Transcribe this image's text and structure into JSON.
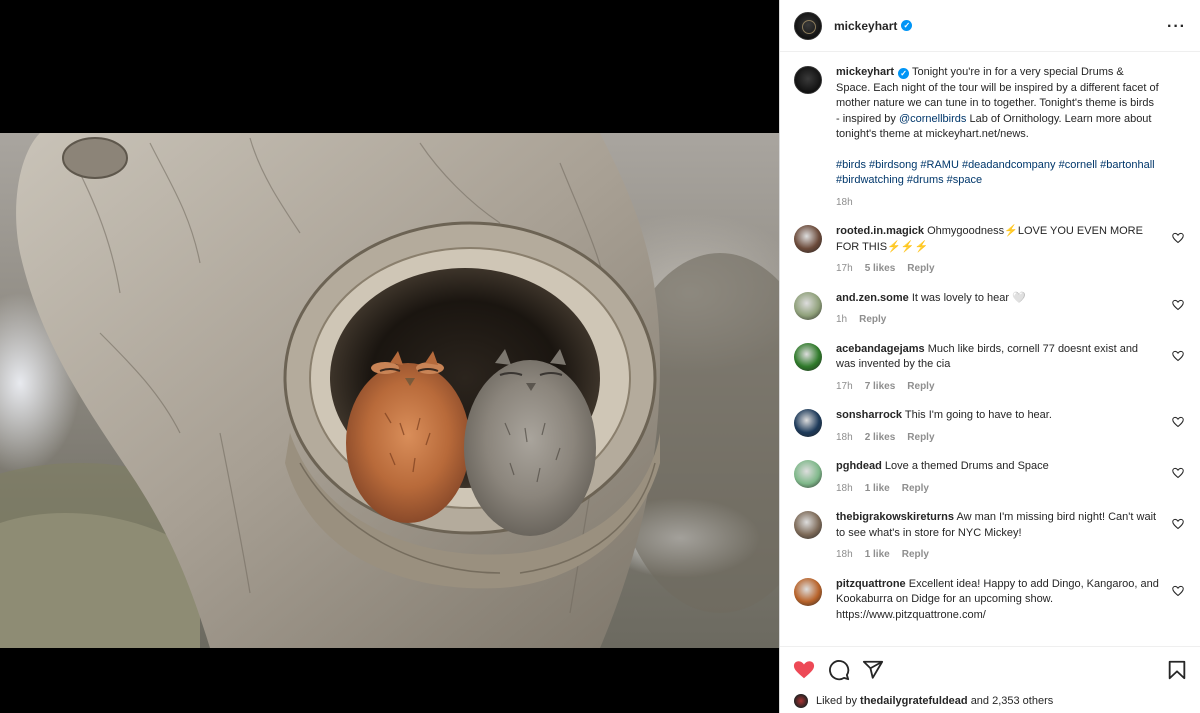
{
  "post": {
    "username": "mickeyhart",
    "verified_mark": "✓",
    "more_icon": "more-horizontal-icon"
  },
  "caption": {
    "username": "mickeyhart",
    "text_part1": "Tonight you're in for a very special Drums & Space. Each night of the tour will be inspired by a different facet of mother nature we can tune in to together. Tonight's theme is birds - inspired by ",
    "mention": "@cornellbirds",
    "text_part2": " Lab of Ornithology. Learn more about tonight's theme at mickeyhart.net/news.",
    "hashtags": "#birds #birdsong #RAMU #deadandcompany #cornell #bartonhall #birdwatching #drums #space",
    "time": "18h"
  },
  "comments": [
    {
      "user": "rooted.in.magick",
      "text": "Ohmygoodness⚡LOVE YOU EVEN MORE FOR THIS⚡⚡⚡",
      "time": "17h",
      "likes": "5 likes",
      "reply": "Reply",
      "avatar_color": "#6b4a3a"
    },
    {
      "user": "and.zen.some",
      "text": "It was lovely to hear 🤍",
      "time": "1h",
      "likes": "",
      "reply": "Reply",
      "avatar_color": "#8fa07a"
    },
    {
      "user": "acebandagejams",
      "text": "Much like birds, cornell 77 doesnt exist and was invented by the cia",
      "time": "17h",
      "likes": "7 likes",
      "reply": "Reply",
      "avatar_color": "#2f7a2a"
    },
    {
      "user": "sonsharrock",
      "text": "This I'm going to have to hear.",
      "time": "18h",
      "likes": "2 likes",
      "reply": "Reply",
      "avatar_color": "#1d3a5a"
    },
    {
      "user": "pghdead",
      "text": "Love a themed Drums and Space",
      "time": "18h",
      "likes": "1 like",
      "reply": "Reply",
      "avatar_color": "#7fb88a"
    },
    {
      "user": "thebigrakowskireturns",
      "text": "Aw man I'm missing bird night! Can't wait to see what's in store for NYC Mickey!",
      "time": "18h",
      "likes": "1 like",
      "reply": "Reply",
      "avatar_color": "#7d6a58"
    },
    {
      "user": "pitzquattrone",
      "text": "Excellent idea! Happy to add Dingo, Kangaroo, and Kookaburra on Didge for an upcoming show. https://www.pitzquattrone.com/",
      "time": "",
      "likes": "",
      "reply": "",
      "avatar_color": "#b8632a"
    }
  ],
  "actions": {
    "like_icon": "heart-filled-icon",
    "comment_icon": "comment-icon",
    "share_icon": "share-icon",
    "save_icon": "bookmark-icon",
    "like_color": "#ed4956"
  },
  "liked_by": {
    "prefix": "Liked by",
    "user": "thedailygratefuldead",
    "suffix": "and 2,353 others"
  }
}
